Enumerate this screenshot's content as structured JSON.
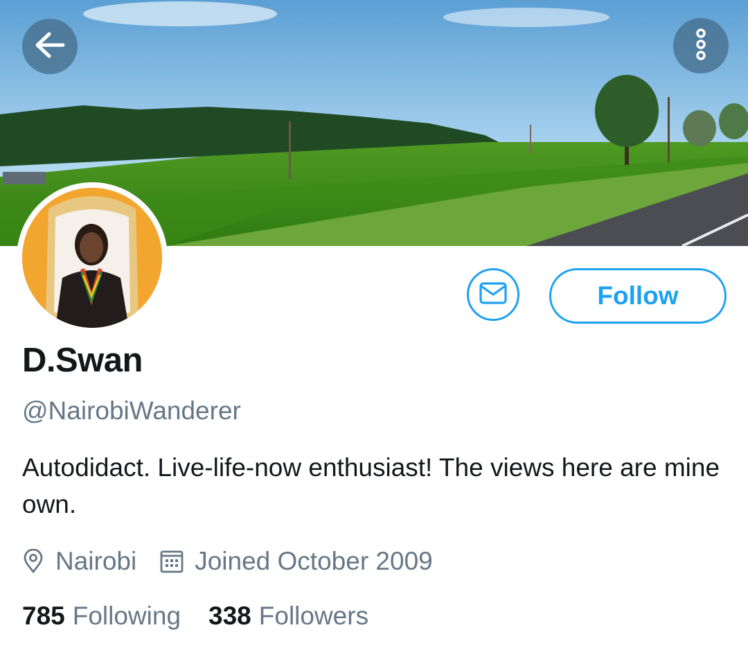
{
  "profile": {
    "display_name": "D.Swan",
    "handle": "@NairobiWanderer",
    "bio": "Autodidact. Live-life-now enthusiast! The views here are mine own.",
    "location": "Nairobi",
    "joined": "Joined October 2009",
    "following_count": "785",
    "following_label": "Following",
    "followers_count": "338",
    "followers_label": "Followers"
  },
  "actions": {
    "follow_label": "Follow"
  },
  "icons": {
    "back": "arrow-left-icon",
    "more": "more-vertical-icon",
    "message": "envelope-icon",
    "location": "location-pin-icon",
    "joined": "calendar-icon"
  },
  "colors": {
    "accent": "#1da1f2",
    "text_primary": "#14171a",
    "text_secondary": "#657786"
  }
}
